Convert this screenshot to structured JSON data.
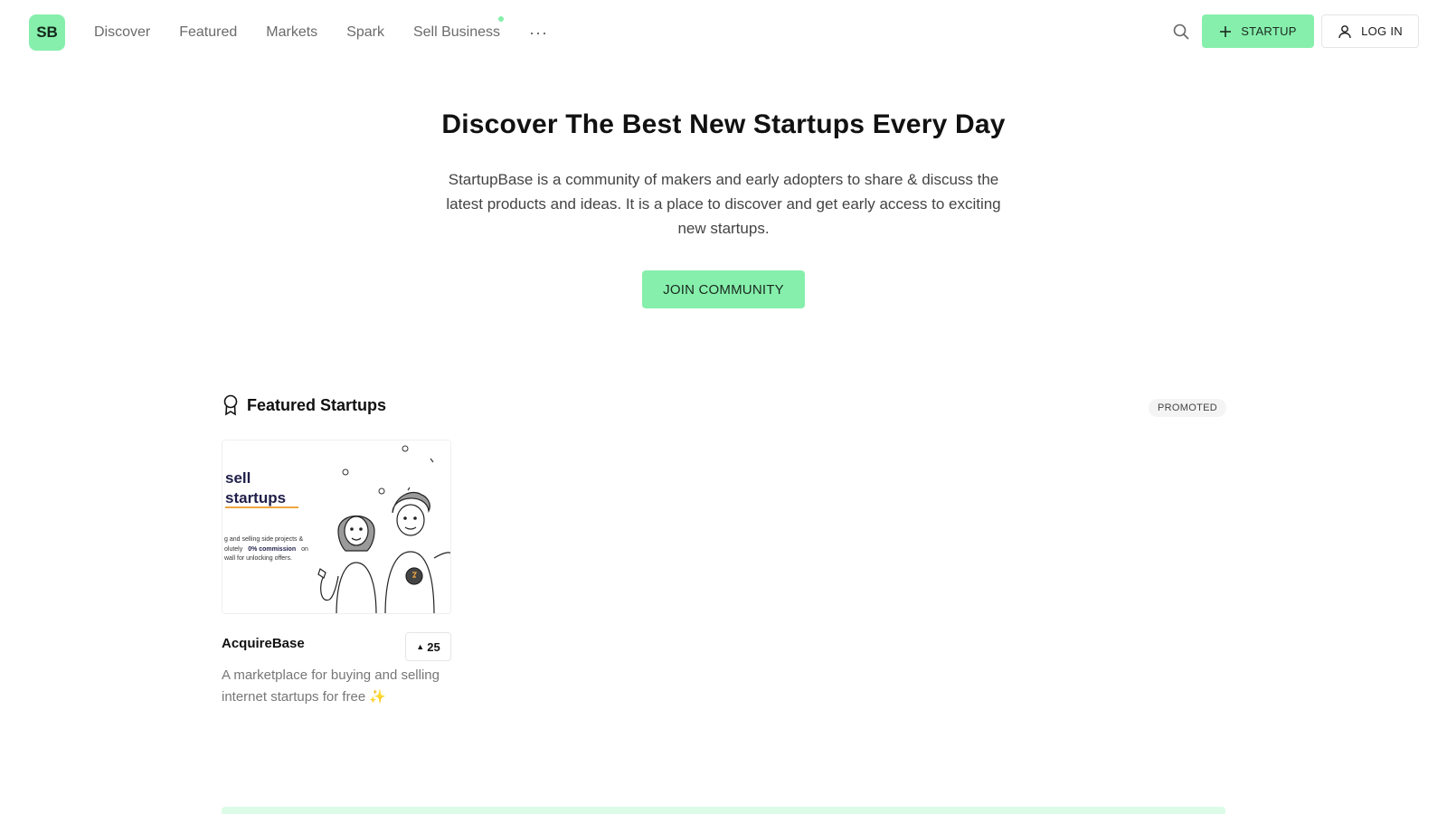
{
  "brand": {
    "logo_text": "SB",
    "accent_color": "#86efac"
  },
  "nav": {
    "items": [
      {
        "label": "Discover"
      },
      {
        "label": "Featured"
      },
      {
        "label": "Markets"
      },
      {
        "label": "Spark"
      },
      {
        "label": "Sell Business",
        "has_dot": true
      }
    ],
    "more_label": "···"
  },
  "header": {
    "search_icon": "search-icon",
    "startup_button_label": "STARTUP",
    "login_button_label": "LOG IN"
  },
  "hero": {
    "title": "Discover The Best New Startups Every Day",
    "description": "StartupBase is a community of makers and early adopters to share & discuss the latest products and ideas. It is a place to discover and get early access to exciting new startups.",
    "cta_label": "JOIN COMMUNITY"
  },
  "featured": {
    "title": "Featured Startups",
    "icon": "award-ribbon-icon",
    "promoted_label": "PROMOTED",
    "cards": [
      {
        "name": "AcquireBase",
        "votes": "25",
        "description": "A marketplace for buying and selling internet startups for free",
        "sparkle": "✨",
        "image": {
          "headline_line1": "sell",
          "headline_line2": "startups",
          "body_line1": "g and selling side projects &",
          "body_line2_a": "olutely",
          "body_line2_highlight": "0% commission",
          "body_line2_b": "on",
          "body_line3": "wall for unlocking offers."
        }
      }
    ]
  }
}
